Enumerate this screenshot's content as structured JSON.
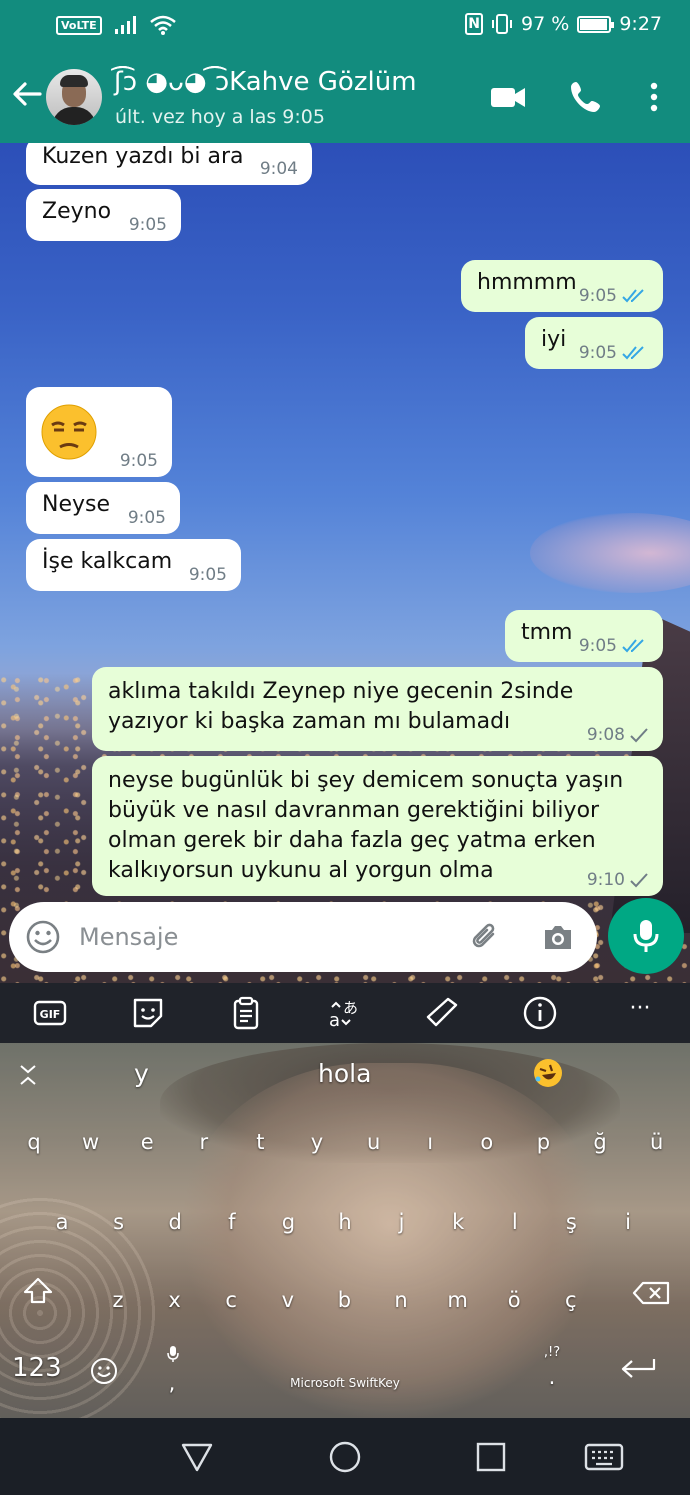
{
  "status_bar": {
    "volte": "VoLTE",
    "nfc": "N",
    "battery_text": "97 %",
    "battery_level": 0.97,
    "time": "9:27"
  },
  "header": {
    "contact_name": "ʃ͡͡ᴐ ◕ᴗ◕ ͡͡ᴐKahve Gözlüm",
    "last_seen": "últ. vez hoy a las 9:05",
    "icons": [
      "back-arrow-icon",
      "video-call-icon",
      "phone-icon",
      "more-options-icon"
    ]
  },
  "messages": [
    {
      "dir": "in",
      "text": "Kuzen yazdı bi ara",
      "time": "9:04"
    },
    {
      "dir": "in",
      "text": "Zeyno",
      "time": "9:05"
    },
    {
      "dir": "out",
      "text": "hmmmm",
      "time": "9:05",
      "status": "read"
    },
    {
      "dir": "out",
      "text": "iyi",
      "time": "9:05",
      "status": "read"
    },
    {
      "dir": "in",
      "emoji": "unamused-face",
      "text": "",
      "time": "9:05"
    },
    {
      "dir": "in",
      "text": "Neyse",
      "time": "9:05"
    },
    {
      "dir": "in",
      "text": "İşe kalkcam",
      "time": "9:05"
    },
    {
      "dir": "out",
      "text": "tmm",
      "time": "9:05",
      "status": "read"
    },
    {
      "dir": "out",
      "text": "aklıma takıldı Zeynep niye gecenin 2sinde\nyazıyor ki başka zaman mı bulamadı",
      "time": "9:08",
      "status": "sent"
    },
    {
      "dir": "out",
      "text": "neyse bugünlük bi şey demicem sonuçta yaşın\nbüyük ve nasıl davranman gerektiğini biliyor\nolman gerek bir daha fazla geç yatma erken\nkalkıyorsun uykunu al yorgun olma",
      "time": "9:10",
      "status": "sent"
    }
  ],
  "input": {
    "placeholder": "Mensaje"
  },
  "keyboard": {
    "toolbar": [
      "gif-icon",
      "sticker-icon",
      "clipboard-icon",
      "translate-icon",
      "handwriting-icon",
      "info-icon",
      "more-icon"
    ],
    "gif_label": "GIF",
    "more_label": "···",
    "suggestions": [
      "y",
      "hola"
    ],
    "row1": [
      "q",
      "w",
      "e",
      "r",
      "t",
      "y",
      "u",
      "ı",
      "o",
      "p",
      "ğ",
      "ü"
    ],
    "row2": [
      "a",
      "s",
      "d",
      "f",
      "g",
      "h",
      "j",
      "k",
      "l",
      "ş",
      "i"
    ],
    "row3": [
      "z",
      "x",
      "c",
      "v",
      "b",
      "n",
      "m",
      "ö",
      "ç"
    ],
    "numbers_key": "123",
    "comma_key": ",",
    "period_key": ".",
    "punct_hint": ",!?",
    "brand": "Microsoft SwiftKey"
  }
}
